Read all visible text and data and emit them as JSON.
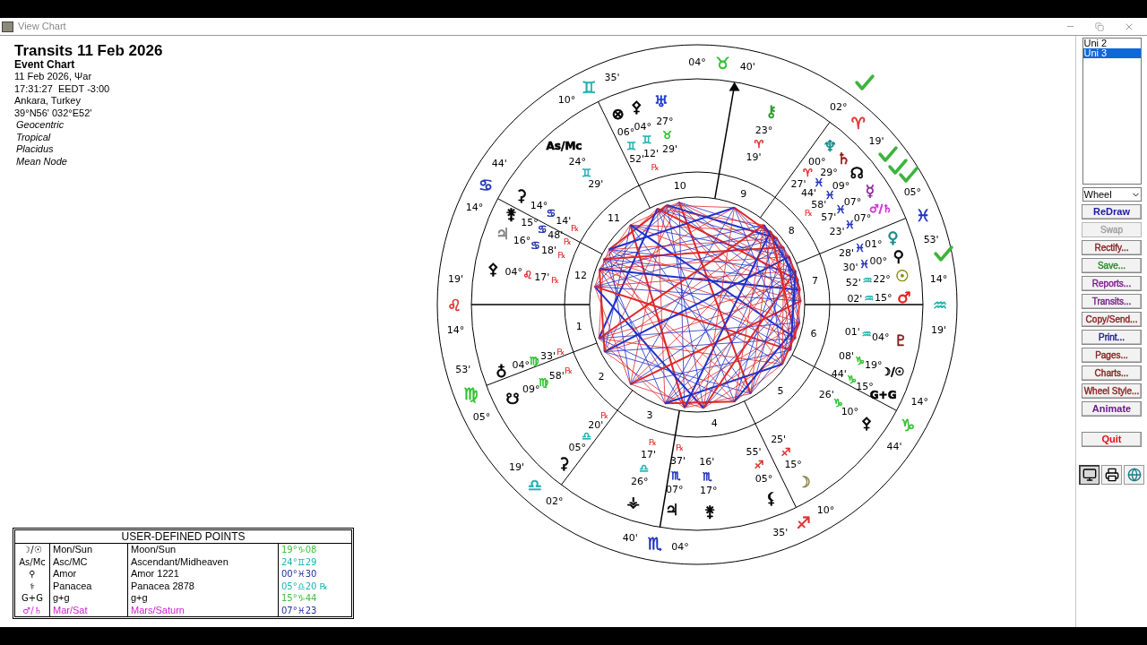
{
  "window": {
    "title": "View Chart"
  },
  "info": [
    {
      "kind": "title",
      "text": "Transits 11 Feb 2026"
    },
    {
      "kind": "subtitle",
      "text": "Event Chart"
    },
    {
      "kind": "plain",
      "text": "11 Feb 2026, Ψar"
    },
    {
      "kind": "plain",
      "text": "17:31:27  EEDT -3:00"
    },
    {
      "kind": "plain",
      "text": "Ankara, Turkey"
    },
    {
      "kind": "plain",
      "text": "39°N56' 032°E52'"
    },
    {
      "kind": "italic",
      "text": "Geocentric"
    },
    {
      "kind": "italic",
      "text": "Tropical"
    },
    {
      "kind": "italic",
      "text": "Placidus"
    },
    {
      "kind": "italic",
      "text": "Mean Node"
    }
  ],
  "wheel": {
    "cusps": [
      {
        "deg": "14°",
        "sign": {
          "text": "♌",
          "color": "#e03030"
        },
        "min": "19'"
      },
      {
        "deg": "05°",
        "sign": {
          "text": "♍",
          "color": "#30c030"
        },
        "min": "53'"
      },
      {
        "deg": "02°",
        "sign": {
          "text": "♎",
          "color": "#20b0b0"
        },
        "min": "19'"
      },
      {
        "deg": "04°",
        "sign": {
          "text": "♏",
          "color": "#2030c0"
        },
        "min": "40'"
      },
      {
        "deg": "10°",
        "sign": {
          "text": "♐",
          "color": "#e03030"
        },
        "min": "35'"
      },
      {
        "deg": "14°",
        "sign": {
          "text": "♑",
          "color": "#30c030"
        },
        "min": "44'"
      },
      {
        "deg": "14°",
        "sign": {
          "text": "♒",
          "color": "#20b0b0"
        },
        "min": "19'"
      },
      {
        "deg": "05°",
        "sign": {
          "text": "♓",
          "color": "#2030c0"
        },
        "min": "53'"
      },
      {
        "deg": "02°",
        "sign": {
          "text": "♈",
          "color": "#e03030"
        },
        "min": "19'"
      },
      {
        "deg": "04°",
        "sign": {
          "text": "♉",
          "color": "#30c030"
        },
        "min": "40'"
      },
      {
        "deg": "10°",
        "sign": {
          "text": "♊",
          "color": "#20b0b0"
        },
        "min": "35'"
      },
      {
        "deg": "14°",
        "sign": {
          "text": "♋",
          "color": "#2030c0"
        },
        "min": "44'"
      }
    ],
    "houses": [
      "1",
      "2",
      "3",
      "4",
      "5",
      "6",
      "7",
      "8",
      "9",
      "10",
      "11",
      "12"
    ],
    "planets": [
      {
        "glyph": "♅",
        "color": "#1a3ad0",
        "deg": "27°",
        "sign": {
          "text": "♉",
          "color": "#30c030"
        },
        "min": "29'"
      },
      {
        "glyph": "⚴",
        "color": "#000000",
        "deg": "04°",
        "sign": {
          "text": "♊",
          "color": "#20b0b0"
        },
        "min": "12'",
        "retro": "℞"
      },
      {
        "glyph": "⊗",
        "color": "#000000",
        "deg": "06°",
        "sign": {
          "text": "♊",
          "color": "#20b0b0"
        },
        "min": "52'"
      },
      {
        "glyph": "As/Mc",
        "color": "#000000",
        "deg": "24°",
        "sign": {
          "text": "♊",
          "color": "#20b0b0"
        },
        "min": "29'"
      },
      {
        "glyph": "⚳",
        "color": "#000000",
        "deg": "14°",
        "sign": {
          "text": "♋",
          "color": "#2030c0"
        },
        "min": "14'",
        "retro": "℞"
      },
      {
        "glyph": "⚵",
        "color": "#000000",
        "deg": "15°",
        "sign": {
          "text": "♋",
          "color": "#2030c0"
        },
        "min": "48'",
        "retro": "℞"
      },
      {
        "glyph": "♃",
        "color": "#808080",
        "deg": "16°",
        "sign": {
          "text": "♋",
          "color": "#2030c0"
        },
        "min": "18'",
        "retro": "℞"
      },
      {
        "glyph": "⚴",
        "color": "#000000",
        "deg": "04°",
        "sign": {
          "text": "♌",
          "color": "#e03030"
        },
        "min": "17'",
        "retro": "℞"
      },
      {
        "glyph": "♁",
        "color": "#000000",
        "deg": "04°",
        "sign": {
          "text": "♍",
          "color": "#30c030"
        },
        "min": "33'",
        "retro": "℞"
      },
      {
        "glyph": "☋",
        "color": "#000000",
        "deg": "09°",
        "sign": {
          "text": "♍",
          "color": "#30c030"
        },
        "min": "58'",
        "retro": "℞"
      },
      {
        "glyph": "⚳",
        "color": "#000000",
        "deg": "05°",
        "sign": {
          "text": "♎",
          "color": "#20b0b0"
        },
        "min": "20'",
        "retro": "℞"
      },
      {
        "glyph": "⚶",
        "color": "#000000",
        "deg": "26°",
        "sign": {
          "text": "♎",
          "color": "#20b0b0"
        },
        "min": "17'",
        "retro": "℞"
      },
      {
        "glyph": "♃",
        "color": "#000000",
        "deg": "07°",
        "sign": {
          "text": "♏",
          "color": "#2030c0"
        },
        "min": "37'",
        "retro": "℞"
      },
      {
        "glyph": "⚵",
        "color": "#000000",
        "deg": "17°",
        "sign": {
          "text": "♏",
          "color": "#2030c0"
        },
        "min": "16'"
      },
      {
        "glyph": "⚸",
        "color": "#000000",
        "deg": "05°",
        "sign": {
          "text": "♐",
          "color": "#e03030"
        },
        "min": "55'"
      },
      {
        "glyph": "☽",
        "color": "#8a8040",
        "deg": "15°",
        "sign": {
          "text": "♐",
          "color": "#e03030"
        },
        "min": "25'"
      },
      {
        "glyph": "⚷",
        "color": "#2a9a2a",
        "deg": "23°",
        "sign": {
          "text": "♈",
          "color": "#e03030"
        },
        "min": "19'"
      },
      {
        "glyph": "♆",
        "color": "#1a8a8a",
        "deg": "00°",
        "sign": {
          "text": "♈",
          "color": "#e03030"
        },
        "min": "27'"
      },
      {
        "glyph": "♄",
        "color": "#8b1a1a",
        "deg": "29°",
        "sign": {
          "text": "♓",
          "color": "#2030c0"
        },
        "min": "44'"
      },
      {
        "glyph": "☊",
        "color": "#000000",
        "deg": "09°",
        "sign": {
          "text": "♓",
          "color": "#2030c0"
        },
        "min": "58'",
        "retro": "℞"
      },
      {
        "glyph": "☿",
        "color": "#8a2a9a",
        "deg": "07°",
        "sign": {
          "text": "♓",
          "color": "#2030c0"
        },
        "min": "57'"
      },
      {
        "glyph": "♂/♄",
        "color": "#d030d0",
        "deg": "07°",
        "sign": {
          "text": "♓",
          "color": "#2030c0"
        },
        "min": "23'"
      },
      {
        "glyph": "♀",
        "color": "#1a8a8a",
        "deg": "01°",
        "sign": {
          "text": "♓",
          "color": "#2030c0"
        },
        "min": "28'"
      },
      {
        "glyph": "⚲",
        "color": "#000000",
        "deg": "00°",
        "sign": {
          "text": "♓",
          "color": "#2030c0"
        },
        "min": "30'"
      },
      {
        "glyph": "☉",
        "color": "#8a8a10",
        "deg": "22°",
        "sign": {
          "text": "♒",
          "color": "#20b0b0"
        },
        "min": "52'"
      },
      {
        "glyph": "♂",
        "color": "#e02020",
        "deg": "15°",
        "sign": {
          "text": "♒",
          "color": "#20b0b0"
        },
        "min": "02'"
      },
      {
        "glyph": "♇",
        "color": "#8b1a1a",
        "deg": "04°",
        "sign": {
          "text": "♒",
          "color": "#20b0b0"
        },
        "min": "01'"
      },
      {
        "glyph": "☽/☉",
        "color": "#000000",
        "deg": "19°",
        "sign": {
          "text": "♑",
          "color": "#30c030"
        },
        "min": "08'"
      },
      {
        "glyph": "G+G",
        "color": "#000000",
        "deg": "15°",
        "sign": {
          "text": "♑",
          "color": "#30c030"
        },
        "min": "44'"
      },
      {
        "glyph": "⚴",
        "color": "#000000",
        "deg": "10°",
        "sign": {
          "text": "♑",
          "color": "#30c030"
        },
        "min": "26'"
      }
    ]
  },
  "user_defined_points": {
    "title": "USER-DEFINED POINTS",
    "rows": [
      {
        "glyph": "☽/☉",
        "short": "Mon/Sun",
        "name": "Moon/Sun",
        "position": "19°♑08",
        "color": "#40c040",
        "highlighted": false
      },
      {
        "glyph": "As/Mc",
        "short": "Asc/MC",
        "name": "Ascendant/Midheaven",
        "position": "24°♊29",
        "color": "#20b0b0",
        "highlighted": false
      },
      {
        "glyph": "⚲",
        "short": "Amor",
        "name": "Amor 1221",
        "position": "00°♓30",
        "color": "#2030a0",
        "highlighted": false
      },
      {
        "glyph": "⚕",
        "short": "Panacea",
        "name": "Panacea 2878",
        "position": "05°♎20 ℞",
        "color": "#20b0b0",
        "highlighted": false
      },
      {
        "glyph": "G+G",
        "short": "g+g",
        "name": "g+g",
        "position": "15°♑44",
        "color": "#40c040",
        "highlighted": false
      },
      {
        "glyph": "♂/♄",
        "short": "Mar/Sat",
        "name": "Mars/Saturn",
        "position": "07°♓23",
        "color": "#2030a0",
        "highlighted": true
      }
    ]
  },
  "sidebar": {
    "list": [
      {
        "label": "Uni 2",
        "selected": false
      },
      {
        "label": "Uni 3",
        "selected": true
      }
    ],
    "dropdown": "Wheel",
    "buttons": [
      {
        "label": "ReDraw",
        "color": "#1a1aa0",
        "bold": true,
        "disabled": false
      },
      {
        "label": "Swap",
        "color": "#a0a0a0",
        "bold": false,
        "disabled": true
      },
      {
        "label": "Rectify...",
        "color": "#8b2020",
        "bold": false,
        "disabled": false
      },
      {
        "label": "Save...",
        "color": "#2a8a2a",
        "bold": false,
        "disabled": false
      },
      {
        "label": "Reports...",
        "color": "#7a1a8a",
        "bold": false,
        "disabled": false
      },
      {
        "label": "Transits...",
        "color": "#7a1a8a",
        "bold": false,
        "disabled": false
      },
      {
        "label": "Copy/Send...",
        "color": "#8b2020",
        "bold": false,
        "disabled": false
      },
      {
        "label": "Print...",
        "color": "#1a1a8a",
        "bold": false,
        "disabled": false
      },
      {
        "label": "Pages...",
        "color": "#8b2020",
        "bold": false,
        "disabled": false
      },
      {
        "label": "Charts...",
        "color": "#8b2020",
        "bold": false,
        "disabled": false
      },
      {
        "label": "Wheel Style...",
        "color": "#8b2020",
        "bold": false,
        "disabled": false
      },
      {
        "label": "Animate",
        "color": "#6a1a8a",
        "bold": true,
        "disabled": false
      },
      {
        "label": "Quit",
        "color": "#e01010",
        "bold": true,
        "disabled": false
      }
    ],
    "output_buttons": [
      {
        "kind": "screen",
        "selected": true
      },
      {
        "kind": "printer",
        "selected": false
      },
      {
        "kind": "web",
        "selected": false
      }
    ]
  }
}
